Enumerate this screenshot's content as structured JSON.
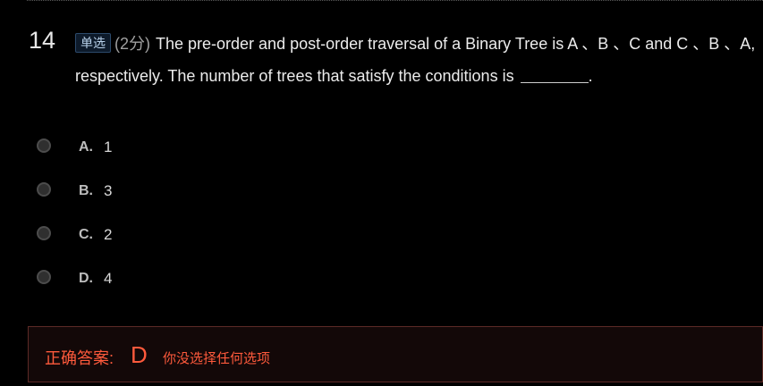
{
  "question": {
    "number": "14",
    "type_badge": "单选",
    "score": "(2分)",
    "text": "The pre-order and post-order traversal of a Binary Tree is A 、B 、C and C 、B 、A, respectively. The number of trees that satisfy the conditions is",
    "text_end": "."
  },
  "options": [
    {
      "letter": "A.",
      "text": "1"
    },
    {
      "letter": "B.",
      "text": "3"
    },
    {
      "letter": "C.",
      "text": "2"
    },
    {
      "letter": "D.",
      "text": "4"
    }
  ],
  "answer": {
    "label": "正确答案:",
    "value": "D",
    "note": "你没选择任何选项"
  },
  "colors": {
    "background": "#000000",
    "answer_accent": "#ff5a3c",
    "badge_text": "#b8d1ea"
  }
}
